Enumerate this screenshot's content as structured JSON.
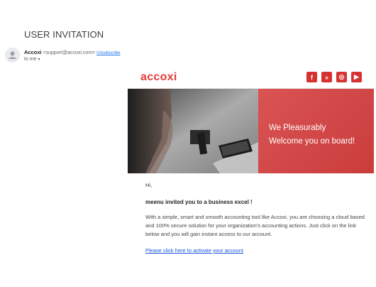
{
  "email": {
    "subject": "USER INVITATION",
    "sender_name": "Accoxi",
    "sender_email": "<support@accoxi.com>",
    "unsubscribe_label": "Unsubscribe",
    "to_label": "to me"
  },
  "newsletter": {
    "logo": "accoxi",
    "social": [
      "f",
      "»",
      "◎",
      "▶"
    ],
    "social_icons": [
      "facebook-icon",
      "twitter-icon",
      "instagram-icon",
      "youtube-icon"
    ],
    "banner_line1": "We Pleasurably",
    "banner_line2": "Welcome you on board!",
    "greeting": "Hi,",
    "invite_line": "meenu invited you to a business excel !",
    "paragraph": "With a simple, smart and smooth accounting tool like Accoxi, you are choosing a cloud based and 100% secure solution for your organization's accounting actions. Just click on the link below and you will gain instant access to our account.",
    "activate_link": "Please click here to activate your account"
  },
  "colors": {
    "brand_red": "#d63232",
    "banner_red": "#d64040",
    "link_blue": "#1a56db"
  }
}
